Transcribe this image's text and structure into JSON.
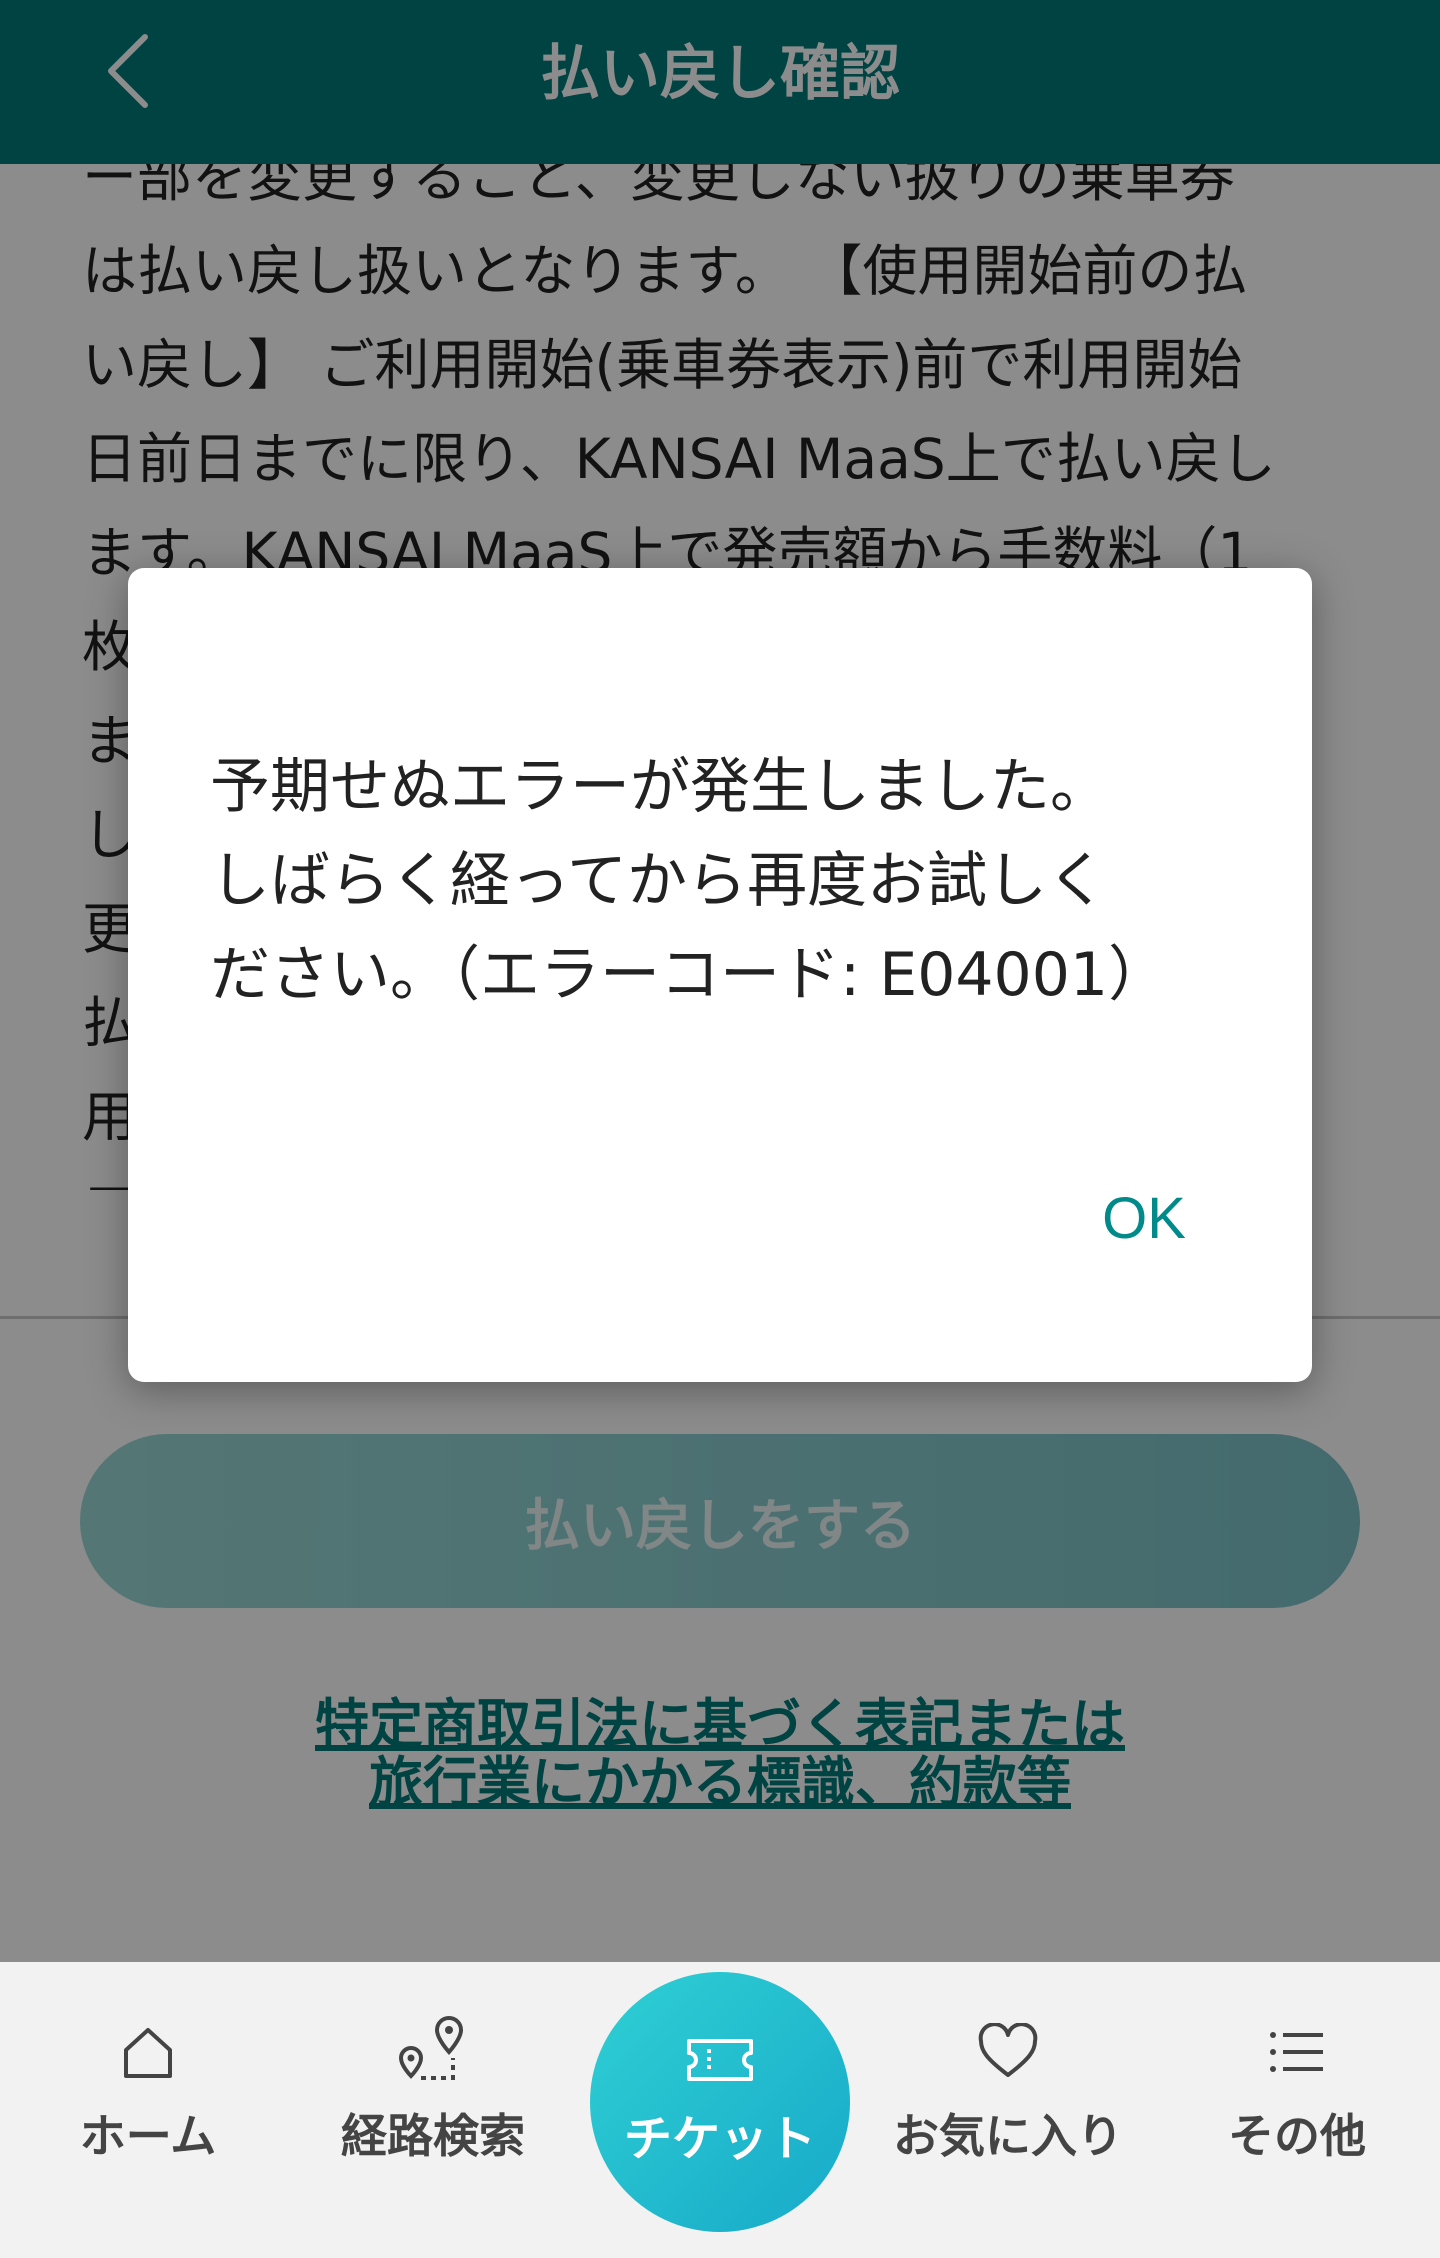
{
  "header": {
    "title": "払い戻し確認",
    "back_icon": "chevron-left-icon"
  },
  "body_text": "ー部を変更すること、変更しない扱りの乗車券\nは払い戻し扱いとなります。 【使用開始前の払\nい戻し】 ご利用開始(乗車券表示)前で利用開始\n日前日までに限り、KANSAI MaaS上で払い戻し\nます。KANSAI MaaS上で発売額から手数料（1\n枚\nま\nし　　　　　　　　　　　　　　　　　　変\n更　　　　　　　　　　　　　　　　　　し\n払　　　　　　　　　　　　　　　　　　使\n用\n示",
  "refund_button_label": "払い戻しをする",
  "legal_link": {
    "line1": "特定商取引法に基づく表記または",
    "line2": "旅行業にかかる標識、約款等"
  },
  "dialog": {
    "message": "予期せぬエラーが発生しました。\nしばらく経ってから再度お試しく\nださい。（エラーコード: E04001）",
    "ok_label": "OK"
  },
  "nav": {
    "home": {
      "label": "ホーム",
      "icon": "home-icon"
    },
    "route": {
      "label": "経路検索",
      "icon": "route-pin-icon"
    },
    "ticket": {
      "label": "チケット",
      "icon": "ticket-icon"
    },
    "favorites": {
      "label": "お気に入り",
      "icon": "heart-icon"
    },
    "other": {
      "label": "その他",
      "icon": "list-icon"
    }
  },
  "colors": {
    "header": "#007a7a",
    "accent": "#008a8a",
    "fab_start": "#2fd0d4",
    "fab_end": "#17a9c9"
  }
}
